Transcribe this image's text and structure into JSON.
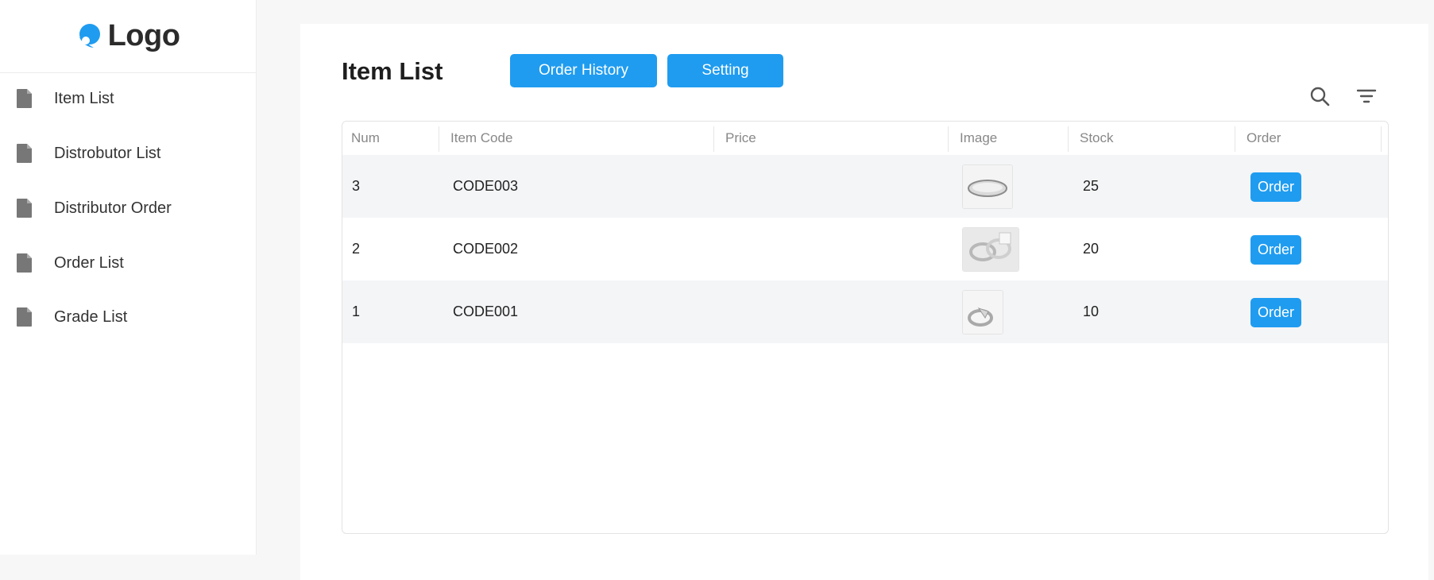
{
  "brand": {
    "logo_text": "Logo",
    "accent_color": "#1f9cf0"
  },
  "sidebar": {
    "items": [
      {
        "label": "Item List",
        "icon": "document-icon"
      },
      {
        "label": "Distrobutor List",
        "icon": "document-icon"
      },
      {
        "label": "Distributor Order",
        "icon": "document-icon"
      },
      {
        "label": "Order List",
        "icon": "document-icon"
      },
      {
        "label": "Grade List",
        "icon": "document-icon"
      }
    ]
  },
  "main": {
    "title": "Item List",
    "buttons": {
      "order_history": "Order History",
      "setting": "Setting"
    },
    "toolbar_icons": [
      "search-icon",
      "filter-icon"
    ]
  },
  "table": {
    "columns": [
      "Num",
      "Item Code",
      "Price",
      "Image",
      "Stock",
      "Order"
    ],
    "rows": [
      {
        "num": "3",
        "item_code": "CODE003",
        "price": "",
        "image": "ring-tray-thumbnail",
        "stock": "25",
        "order_label": "Order"
      },
      {
        "num": "2",
        "item_code": "CODE002",
        "price": "",
        "image": "silver-rings-thumbnail",
        "stock": "20",
        "order_label": "Order"
      },
      {
        "num": "1",
        "item_code": "CODE001",
        "price": "",
        "image": "silver-ring-thumbnail",
        "stock": "10",
        "order_label": "Order"
      }
    ]
  }
}
